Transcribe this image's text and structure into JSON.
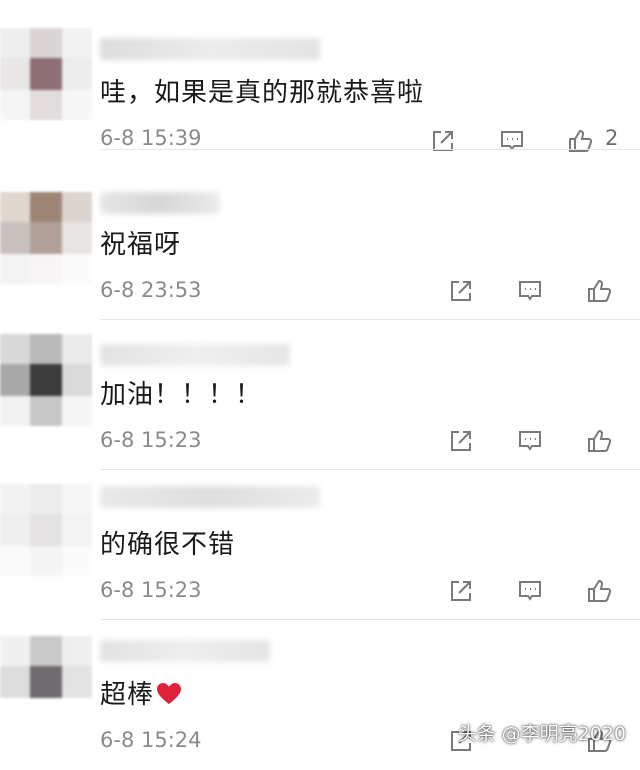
{
  "comments": [
    {
      "text": "哇，如果是真的那就恭喜啦",
      "time": "6-8 15:39",
      "likes": "2"
    },
    {
      "text": "祝福呀",
      "time": "6-8 23:53",
      "likes": ""
    },
    {
      "text": "加油！！！！",
      "time": "6-8 15:23",
      "likes": ""
    },
    {
      "text": "的确很不错",
      "time": "6-8 15:23",
      "likes": ""
    },
    {
      "text": "超棒",
      "time": "6-8 15:24",
      "likes": "",
      "emoji": "heart"
    }
  ],
  "icons": {
    "share": "share-icon",
    "reply": "reply-icon",
    "like": "thumbs-up-icon",
    "emoji": "heart-icon"
  },
  "colors": {
    "heart": "#e0213a",
    "meta": "#8a8a8a",
    "divider": "#e6e6e6"
  },
  "watermark": "头条 @李明亮2020"
}
